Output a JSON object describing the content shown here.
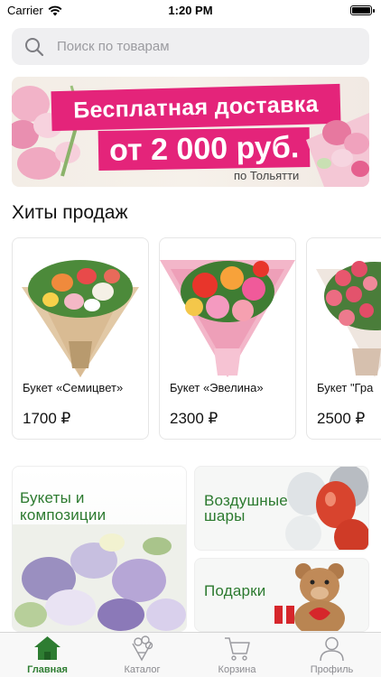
{
  "status_bar": {
    "carrier": "Carrier",
    "time": "1:20 PM"
  },
  "search": {
    "placeholder": "Поиск по товарам",
    "icon": "search-icon"
  },
  "banner": {
    "title": "Бесплатная доставка",
    "amount": "от 2 000 руб.",
    "city": "по Тольятти",
    "color": "#e4247a"
  },
  "hits": {
    "title": "Хиты продаж",
    "products": [
      {
        "name": "Букет «Семицвет»",
        "price": "1700 ₽"
      },
      {
        "name": "Букет «Эвелина»",
        "price": "2300 ₽"
      },
      {
        "name": "Букет \"Гра",
        "price": "2500 ₽"
      }
    ]
  },
  "categories": {
    "bouquets_line1": "Букеты и",
    "bouquets_line2": "композиции",
    "balloons_line1": "Воздушные",
    "balloons_line2": "шары",
    "gifts": "Подарки",
    "label_color": "#2c7a2f"
  },
  "tab_bar": {
    "items": [
      {
        "label": "Главная",
        "icon": "home-icon",
        "active": true
      },
      {
        "label": "Каталог",
        "icon": "bouquet-icon",
        "active": false
      },
      {
        "label": "Корзина",
        "icon": "cart-icon",
        "active": false
      },
      {
        "label": "Профиль",
        "icon": "profile-icon",
        "active": false
      }
    ],
    "active_color": "#2e7d32"
  }
}
